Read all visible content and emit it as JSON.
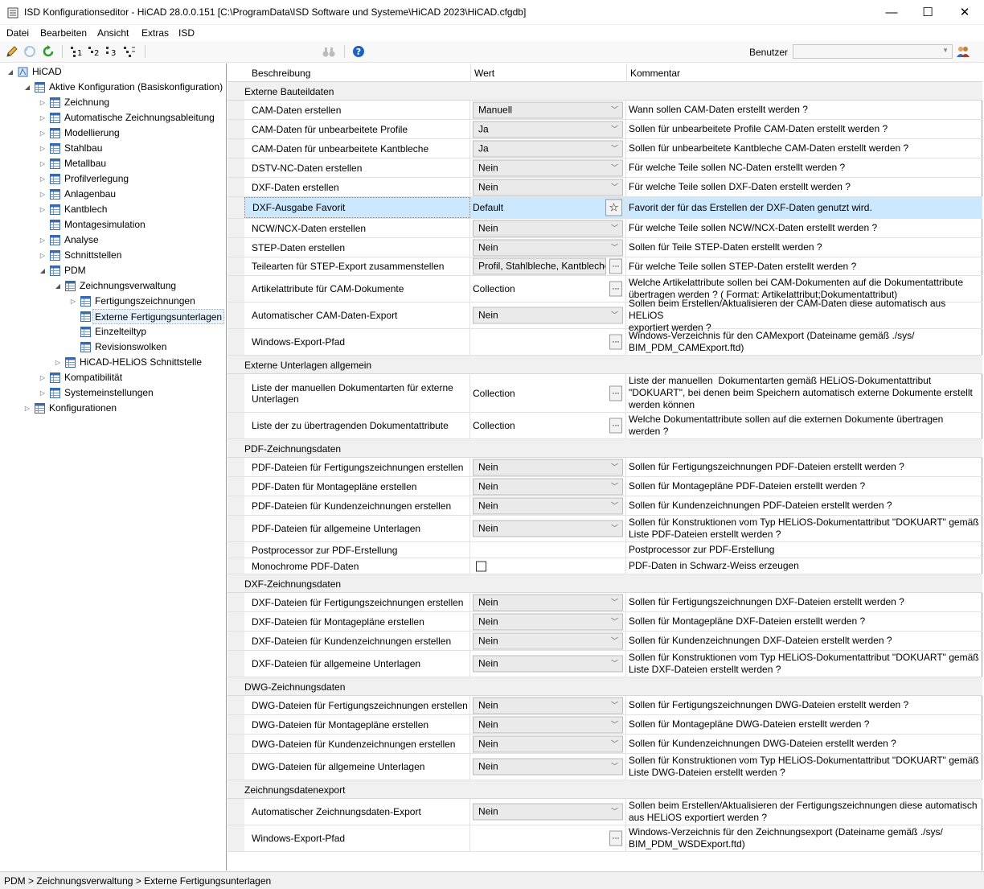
{
  "window": {
    "title": "ISD Konfigurationseditor  -  HiCAD 28.0.0.151 [C:\\ProgramData\\ISD Software und Systeme\\HiCAD 2023\\HiCAD.cfgdb]",
    "minimize": "—",
    "maximize": "☐",
    "close": "✕"
  },
  "menu": [
    "Datei",
    "Bearbeiten",
    "Ansicht",
    "Extras",
    "ISD"
  ],
  "toolbar": {
    "user_label": "Benutzer",
    "user_value": ""
  },
  "tree": [
    {
      "label": "HiCAD",
      "depth": 0,
      "arrow": "open",
      "icon": "hicad-icon"
    },
    {
      "label": "Aktive Konfiguration (Basiskonfiguration)",
      "depth": 1,
      "arrow": "open",
      "icon": "table-icon"
    },
    {
      "label": "Zeichnung",
      "depth": 2,
      "arrow": "closed",
      "icon": "table-icon"
    },
    {
      "label": "Automatische Zeichnungsableitung",
      "depth": 2,
      "arrow": "closed",
      "icon": "table-icon"
    },
    {
      "label": "Modellierung",
      "depth": 2,
      "arrow": "closed",
      "icon": "table-icon"
    },
    {
      "label": "Stahlbau",
      "depth": 2,
      "arrow": "closed",
      "icon": "table-icon"
    },
    {
      "label": "Metallbau",
      "depth": 2,
      "arrow": "closed",
      "icon": "table-icon"
    },
    {
      "label": "Profilverlegung",
      "depth": 2,
      "arrow": "closed",
      "icon": "table-icon"
    },
    {
      "label": "Anlagenbau",
      "depth": 2,
      "arrow": "closed",
      "icon": "table-icon"
    },
    {
      "label": "Kantblech",
      "depth": 2,
      "arrow": "closed",
      "icon": "table-icon"
    },
    {
      "label": "Montagesimulation",
      "depth": 2,
      "arrow": "none",
      "icon": "table-icon"
    },
    {
      "label": "Analyse",
      "depth": 2,
      "arrow": "closed",
      "icon": "table-icon"
    },
    {
      "label": "Schnittstellen",
      "depth": 2,
      "arrow": "closed",
      "icon": "table-icon"
    },
    {
      "label": "PDM",
      "depth": 2,
      "arrow": "open",
      "icon": "table-icon"
    },
    {
      "label": "Zeichnungsverwaltung",
      "depth": 3,
      "arrow": "open",
      "icon": "table-icon"
    },
    {
      "label": "Fertigungszeichnungen",
      "depth": 4,
      "arrow": "closed",
      "icon": "table-icon"
    },
    {
      "label": "Externe Fertigungsunterlagen",
      "depth": 4,
      "arrow": "none",
      "icon": "table-icon",
      "selected": true
    },
    {
      "label": "Einzelteiltyp",
      "depth": 4,
      "arrow": "none",
      "icon": "table-icon"
    },
    {
      "label": "Revisionswolken",
      "depth": 4,
      "arrow": "none",
      "icon": "table-icon"
    },
    {
      "label": "HiCAD-HELiOS Schnittstelle",
      "depth": 3,
      "arrow": "closed",
      "icon": "table-icon"
    },
    {
      "label": "Kompatibilität",
      "depth": 2,
      "arrow": "closed",
      "icon": "table-icon"
    },
    {
      "label": "Systemeinstellungen",
      "depth": 2,
      "arrow": "closed",
      "icon": "table-icon"
    },
    {
      "label": "Konfigurationen",
      "depth": 1,
      "arrow": "closed",
      "icon": "table-icon"
    }
  ],
  "grid": {
    "headers": [
      "Beschreibung",
      "Wert",
      "Kommentar"
    ],
    "sections": [
      {
        "title": "Externe Bauteildaten",
        "rows": [
          {
            "desc": "CAM-Daten erstellen",
            "type": "dropdown",
            "value": "Manuell",
            "comment": "Wann sollen CAM-Daten erstellt werden ?",
            "h": 24
          },
          {
            "desc": "CAM-Daten für unbearbeitete Profile",
            "type": "dropdown",
            "value": "Ja",
            "comment": "Sollen für unbearbeitete Profile CAM-Daten erstellt werden ?",
            "h": 24
          },
          {
            "desc": "CAM-Daten für unbearbeitete Kantbleche",
            "type": "dropdown",
            "value": "Ja",
            "comment": "Sollen für unbearbeitete Kantbleche CAM-Daten erstellt werden ?",
            "h": 24
          },
          {
            "desc": "DSTV-NC-Daten erstellen",
            "type": "dropdown",
            "value": "Nein",
            "comment": "Für welche Teile sollen NC-Daten erstellt werden ?",
            "h": 24
          },
          {
            "desc": "DXF-Daten erstellen",
            "type": "dropdown",
            "value": "Nein",
            "comment": "Für welche Teile sollen DXF-Daten erstellt werden ?",
            "h": 24
          },
          {
            "desc": "DXF-Ausgabe Favorit",
            "type": "star",
            "value": "Default",
            "comment": "Favorit der für das Erstellen der DXF-Daten genutzt wird.",
            "h": 27,
            "highlight": true
          },
          {
            "desc": "NCW/NCX-Daten erstellen",
            "type": "dropdown",
            "value": "Nein",
            "comment": "Für welche Teile sollen NCW/NCX-Daten erstellt werden ?",
            "h": 24
          },
          {
            "desc": "STEP-Daten erstellen",
            "type": "dropdown",
            "value": "Nein",
            "comment": "Sollen für Teile STEP-Daten erstellt werden ?",
            "h": 24
          },
          {
            "desc": "Teilearten für STEP-Export zusammenstellen",
            "type": "textell",
            "value": "Profil, Stahlbleche, Kantbleche",
            "comment": "Für welche Teile sollen STEP-Daten erstellt werden ?",
            "h": 23
          },
          {
            "desc": "Artikelattribute für CAM-Dokumente",
            "type": "collection",
            "value": "Collection",
            "comment": "Welche Artikelattribute sollen bei CAM-Dokumenten auf die Dokumentattribute\nübertragen werden ? ( Format: Artikelattribut;Dokumentattribut)",
            "h": 33
          },
          {
            "desc": "Automatischer CAM-Daten-Export",
            "type": "dropdown",
            "value": "Nein",
            "comment": "Sollen beim Erstellen/Aktualisieren der CAM-Daten diese automatisch aus HELiOS\nexportiert werden ?",
            "h": 33
          },
          {
            "desc": "Windows-Export-Pfad",
            "type": "ellipsis",
            "value": "",
            "comment": "Windows-Verzeichnis für den CAMexport (Dateiname gemäß ./sys/\nBIM_PDM_CAMExport.ftd)",
            "h": 33
          }
        ]
      },
      {
        "title": "Externe Unterlagen allgemein",
        "rows": [
          {
            "desc": "Liste der manuellen Dokumentarten für externe\nUnterlagen",
            "type": "collection",
            "value": "Collection",
            "comment": "Liste der manuellen  Dokumentarten gemäß HELiOS-Dokumentattribut\n\"DOKUART\", bei denen beim Speichern automatisch externe Dokumente erstellt\nwerden können",
            "h": 48
          },
          {
            "desc": "Liste der zu übertragenden Dokumentattribute",
            "type": "collection",
            "value": "Collection",
            "comment": "Welche Dokumentattribute sollen auf die externen Dokumente übertragen\nwerden ?",
            "h": 33
          }
        ]
      },
      {
        "title": "PDF-Zeichnungsdaten",
        "rows": [
          {
            "desc": "PDF-Dateien für Fertigungszeichnungen erstellen",
            "type": "dropdown",
            "value": "Nein",
            "comment": "Sollen für Fertigungszeichnungen PDF-Dateien erstellt werden ?",
            "h": 24
          },
          {
            "desc": "PDF-Daten für Montagepläne erstellen",
            "type": "dropdown",
            "value": "Nein",
            "comment": "Sollen für Montagepläne PDF-Dateien erstellt werden ?",
            "h": 24
          },
          {
            "desc": "PDF-Dateien für Kundenzeichnungen erstellen",
            "type": "dropdown",
            "value": "Nein",
            "comment": "Sollen für Kundenzeichnungen PDF-Dateien erstellt werden ?",
            "h": 24
          },
          {
            "desc": "PDF-Dateien für allgemeine Unterlagen",
            "type": "dropdown",
            "value": "Nein",
            "comment": "Sollen für Konstruktionen vom Typ HELiOS-Dokumentattribut \"DOKUART\" gemäß\nListe PDF-Dateien erstellt werden ?",
            "h": 33
          },
          {
            "desc": "Postprocessor zur PDF-Erstellung",
            "type": "empty",
            "value": "",
            "comment": "Postprocessor zur PDF-Erstellung",
            "h": 20
          },
          {
            "desc": "Monochrome PDF-Daten",
            "type": "checkbox",
            "value": "",
            "comment": "PDF-Daten in Schwarz-Weiss erzeugen",
            "h": 20
          }
        ]
      },
      {
        "title": "DXF-Zeichnungsdaten",
        "rows": [
          {
            "desc": "DXF-Dateien für Fertigungszeichnungen erstellen",
            "type": "dropdown",
            "value": "Nein",
            "comment": "Sollen für Fertigungszeichnungen DXF-Dateien erstellt werden ?",
            "h": 24
          },
          {
            "desc": "DXF-Dateien für Montagepläne erstellen",
            "type": "dropdown",
            "value": "Nein",
            "comment": "Sollen für Montagepläne DXF-Dateien erstellt werden ?",
            "h": 24
          },
          {
            "desc": "DXF-Dateien für Kundenzeichnungen erstellen",
            "type": "dropdown",
            "value": "Nein",
            "comment": "Sollen für Kundenzeichnungen DXF-Dateien erstellt werden ?",
            "h": 24
          },
          {
            "desc": "DXF-Dateien für allgemeine Unterlagen",
            "type": "dropdown",
            "value": "Nein",
            "comment": "Sollen für Konstruktionen vom Typ HELiOS-Dokumentattribut \"DOKUART\" gemäß\nListe DXF-Dateien erstellt werden ?",
            "h": 33
          }
        ]
      },
      {
        "title": "DWG-Zeichnungsdaten",
        "rows": [
          {
            "desc": "DWG-Dateien für Fertigungszeichnungen erstellen",
            "type": "dropdown",
            "value": "Nein",
            "comment": "Sollen für Fertigungszeichnungen DWG-Dateien erstellt werden ?",
            "h": 24
          },
          {
            "desc": "DWG-Dateien für Montagepläne erstellen",
            "type": "dropdown",
            "value": "Nein",
            "comment": "Sollen für Montagepläne DWG-Dateien erstellt werden ?",
            "h": 24
          },
          {
            "desc": "DWG-Dateien für Kundenzeichnungen erstellen",
            "type": "dropdown",
            "value": "Nein",
            "comment": "Sollen für Kundenzeichnungen DWG-Dateien erstellt werden ?",
            "h": 24
          },
          {
            "desc": "DWG-Dateien für allgemeine Unterlagen",
            "type": "dropdown",
            "value": "Nein",
            "comment": "Sollen für Konstruktionen vom Typ HELiOS-Dokumentattribut \"DOKUART\" gemäß\nListe DWG-Dateien erstellt werden ?",
            "h": 33
          }
        ]
      },
      {
        "title": "Zeichnungsdatenexport",
        "rows": [
          {
            "desc": "Automatischer Zeichnungsdaten-Export",
            "type": "dropdown",
            "value": "Nein",
            "comment": "Sollen beim Erstellen/Aktualisieren der Fertigungszeichnungen diese automatisch\naus HELiOS exportiert werden ?",
            "h": 33
          },
          {
            "desc": "Windows-Export-Pfad",
            "type": "ellipsis",
            "value": "",
            "comment": "Windows-Verzeichnis für den Zeichnungsexport (Dateiname gemäß ./sys/\nBIM_PDM_WSDExport.ftd)",
            "h": 33
          }
        ]
      }
    ]
  },
  "status": "PDM > Zeichnungsverwaltung > Externe Fertigungsunterlagen"
}
